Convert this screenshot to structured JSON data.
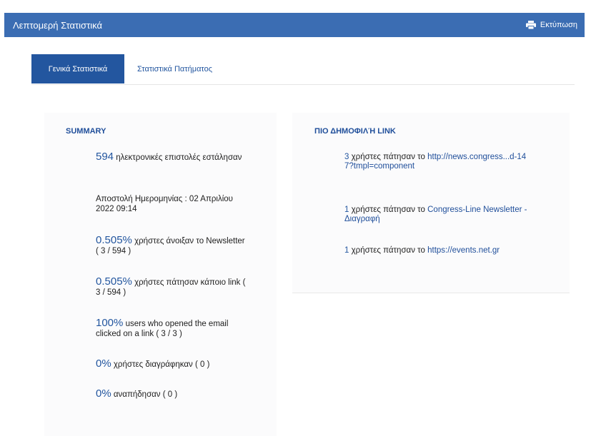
{
  "header": {
    "title": "Λεπτομερή Στατιστικά",
    "print_label": "Εκτύπωση"
  },
  "tabs": [
    {
      "label": "Γενικά Στατιστικά",
      "active": true
    },
    {
      "label": "Στατιστικά Πατήματος",
      "active": false
    }
  ],
  "summary": {
    "title": "SUMMARY",
    "sent": {
      "value": "594",
      "text": "ηλεκτρονικές επιστολές εστάλησαν"
    },
    "send_date": "Αποστολή Ημερομηνίας : 02 Απριλίου 2022 09:14",
    "opened": {
      "value": "0.505%",
      "text": "χρήστες άνοιξαν το Newsletter ( 3 / 594 )"
    },
    "clicked": {
      "value": "0.505%",
      "text": "χρήστες πάτησαν κάποιο link ( 3 / 594 )"
    },
    "opened_clicked": {
      "value": "100%",
      "text": "users who opened the email clicked on a link ( 3 / 3 )"
    },
    "unsubscribed": {
      "value": "0%",
      "text": "χρήστες διαγράφηκαν ( 0 )"
    },
    "bounced": {
      "value": "0%",
      "text": "αναπήδησαν ( 0 )"
    }
  },
  "popular_links": {
    "title": "ΠΙΟ ΔΗΜΟΦΙΛΉ LINK",
    "items": [
      {
        "count": "3",
        "text": "χρήστες πάτησαν το",
        "link": "http://news.congress...d-147?tmpl=component"
      },
      {
        "count": "1",
        "text": "χρήστες πάτησαν το",
        "link": "Congress-Line Newsletter - Διαγραφή"
      },
      {
        "count": "1",
        "text": "χρήστες πάτησαν το",
        "link": "https://events.net.gr"
      }
    ]
  },
  "colors": {
    "header_bg": "#3b6db3",
    "tab_active_bg": "#23569f",
    "accent_text": "#23569f"
  },
  "icons": {
    "print": "printer-icon"
  }
}
